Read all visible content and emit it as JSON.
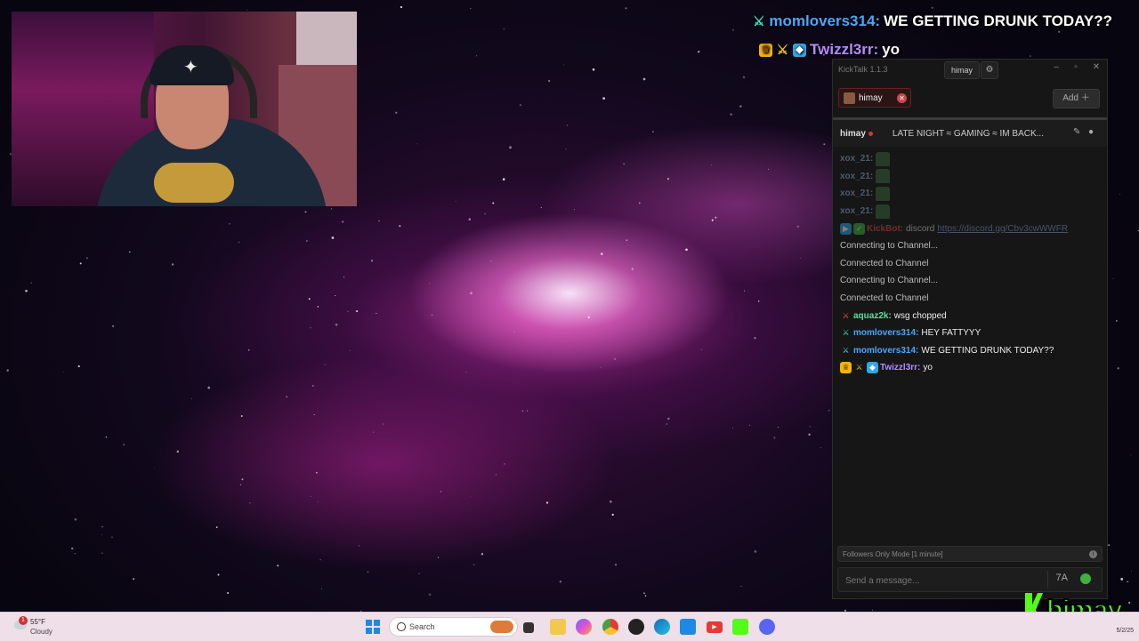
{
  "overlay_chat": [
    {
      "badges": [
        "sword-icon"
      ],
      "user": "momlovers314:",
      "user_color": "#4aa8ff",
      "text": "WE GETTING DRUNK TODAY??"
    },
    {
      "badges": [
        "crown-icon",
        "sword-icon",
        "cube-icon"
      ],
      "user": "Twizzl3rr:",
      "user_color": "#b68bff",
      "text": "yo"
    }
  ],
  "kicktalk": {
    "app_title": "KickTalk 1.1.3",
    "titlebar_user": "himay",
    "tab": {
      "label": "himay"
    },
    "add_button": "Add ＋",
    "channel": {
      "name": "himay",
      "title": "LATE NIGHT ≈ GAMING ≈ IM BACK..."
    },
    "faded_messages": [
      {
        "user": "xox_21:"
      },
      {
        "user": "xox_21:"
      },
      {
        "user": "xox_21:"
      },
      {
        "user": "xox_21:"
      }
    ],
    "faded_link_msg": {
      "user": "KickBot:",
      "text": "discord",
      "link": "https://discord.gg/Cbv3cwWWFR"
    },
    "system_messages": [
      "Connecting to Channel...",
      "Connected to Channel",
      "Connecting to Channel...",
      "Connected to Channel"
    ],
    "messages": [
      {
        "user": "aquaz2k:",
        "user_color": "#5ee0a0",
        "text": "wsg chopped",
        "badges": [
          "sword-red-icon"
        ]
      },
      {
        "user": "momlovers314:",
        "user_color": "#4aa8ff",
        "text": "HEY FATTYYY",
        "badges": [
          "sword-icon"
        ]
      },
      {
        "user": "momlovers314:",
        "user_color": "#4aa8ff",
        "text": "WE GETTING DRUNK TODAY??",
        "badges": [
          "sword-icon"
        ]
      },
      {
        "user": "Twizzl3rr:",
        "user_color": "#b68bff",
        "text": "yo",
        "badges": [
          "crown-icon",
          "sword-yellow-icon",
          "cube-icon"
        ]
      }
    ],
    "followers_mode": "Followers Only Mode [1 minute]",
    "input_placeholder": "Send a message..."
  },
  "taskbar": {
    "weather_temp": "55°F",
    "weather_cond": "Cloudy",
    "weather_badge": "1",
    "search_label": "Search",
    "clock_date": "5/2/25"
  },
  "watermark": "himay",
  "colors": {
    "kick_green": "#53fc18",
    "accent_red": "#c84a4a"
  }
}
